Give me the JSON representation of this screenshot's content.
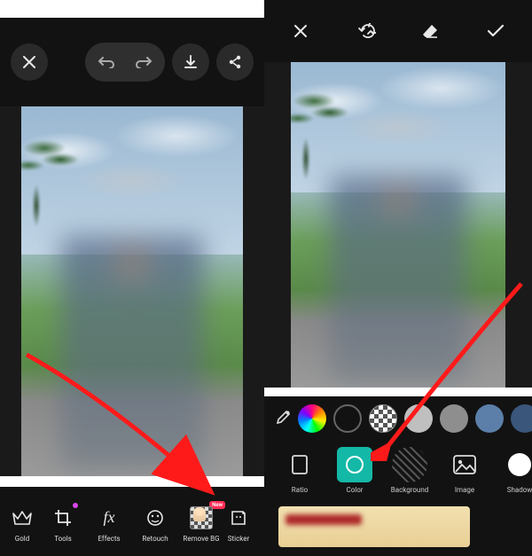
{
  "left": {
    "toolbar": {
      "gold": {
        "label": "Gold"
      },
      "tools": {
        "label": "Tools",
        "badge": true
      },
      "effects": {
        "label": "Effects"
      },
      "retouch": {
        "label": "Retouch"
      },
      "removebg": {
        "label": "Remove BG",
        "badge_label": "New"
      },
      "sticker": {
        "label": "Sticker"
      }
    }
  },
  "right": {
    "swatches": [
      {
        "id": "rainbow",
        "kind": "rainbow"
      },
      {
        "id": "none",
        "kind": "outline"
      },
      {
        "id": "transparent",
        "kind": "checker"
      },
      {
        "id": "grey1",
        "color": "#bfbfbf"
      },
      {
        "id": "grey2",
        "color": "#8e8e8e"
      },
      {
        "id": "blue1",
        "color": "#5b7fa8"
      },
      {
        "id": "blue2",
        "color": "#3a567a"
      }
    ],
    "bgtools": {
      "ratio": {
        "label": "Ratio"
      },
      "color": {
        "label": "Color",
        "selected": true
      },
      "background": {
        "label": "Background"
      },
      "image": {
        "label": "Image"
      },
      "shadow": {
        "label": "Shadow"
      }
    }
  }
}
